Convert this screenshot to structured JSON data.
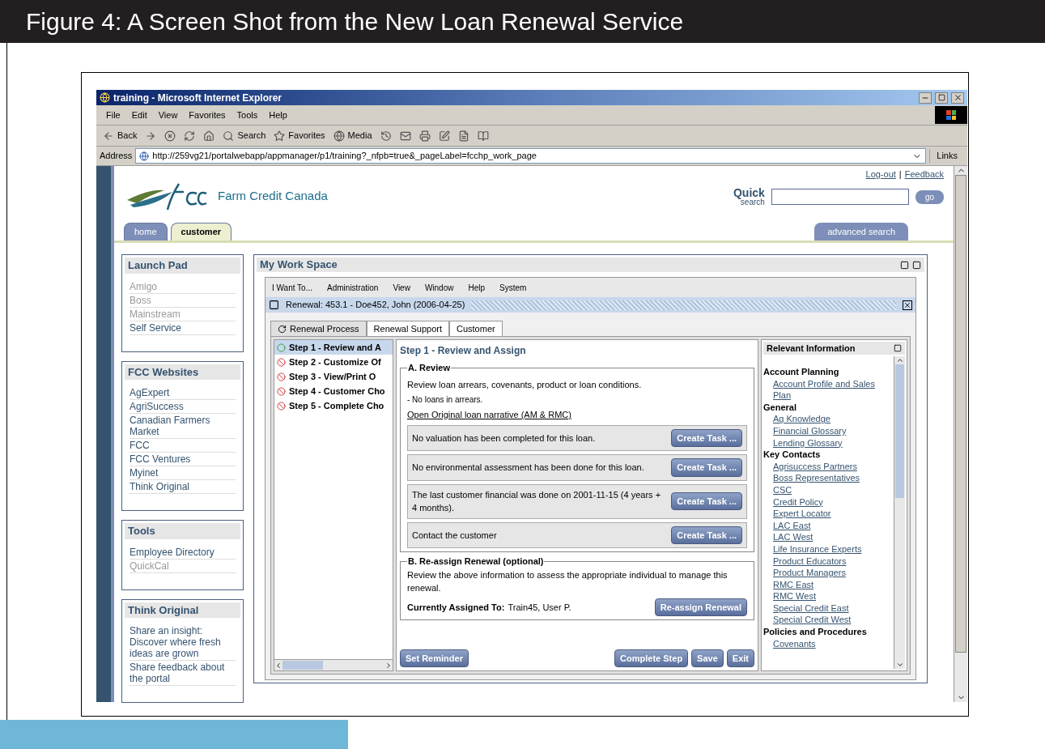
{
  "figure": {
    "caption": "Figure 4: A Screen Shot from the New Loan Renewal Service"
  },
  "browser": {
    "title": "training - Microsoft Internet Explorer",
    "menu": [
      "File",
      "Edit",
      "View",
      "Favorites",
      "Tools",
      "Help"
    ],
    "toolbar": [
      {
        "kind": "back",
        "label": "Back"
      },
      {
        "kind": "forward"
      },
      {
        "kind": "stop"
      },
      {
        "kind": "refresh"
      },
      {
        "kind": "home"
      },
      {
        "kind": "search",
        "label": "Search"
      },
      {
        "kind": "favorites",
        "label": "Favorites"
      },
      {
        "kind": "media",
        "label": "Media"
      },
      {
        "kind": "history"
      },
      {
        "kind": "mail"
      },
      {
        "kind": "print"
      },
      {
        "kind": "edit"
      },
      {
        "kind": "page"
      },
      {
        "kind": "research"
      }
    ],
    "address_label": "Address",
    "url": "http://259vg21/portalwebapp/appmanager/p1/training?_nfpb=true&_pageLabel=fcchp_work_page",
    "links_label": "Links"
  },
  "portal": {
    "brand": "Farm Credit Canada",
    "header_links": [
      "Log-out",
      "Feedback"
    ],
    "separator": "|",
    "quick": "Quick",
    "quick_sub": "search",
    "go": "go",
    "tabs": [
      {
        "label": "home",
        "selected": false
      },
      {
        "label": "customer",
        "selected": true
      }
    ],
    "advanced_search": "advanced search"
  },
  "sidebar": [
    {
      "title": "Launch Pad",
      "items": [
        {
          "label": "Amigo",
          "disabled": true
        },
        {
          "label": "Boss",
          "disabled": true
        },
        {
          "label": "Mainstream",
          "disabled": true
        },
        {
          "label": "Self Service",
          "disabled": false
        }
      ]
    },
    {
      "title": "FCC Websites",
      "items": [
        {
          "label": "AgExpert",
          "disabled": false
        },
        {
          "label": "AgriSuccess",
          "disabled": false
        },
        {
          "label": "Canadian Farmers Market",
          "disabled": false
        },
        {
          "label": "FCC",
          "disabled": false
        },
        {
          "label": "FCC Ventures",
          "disabled": false
        },
        {
          "label": "Myinet",
          "disabled": false
        },
        {
          "label": "Think Original",
          "disabled": false
        }
      ]
    },
    {
      "title": "Tools",
      "items": [
        {
          "label": "Employee Directory",
          "disabled": false
        },
        {
          "label": "QuickCal",
          "disabled": true
        }
      ]
    },
    {
      "title": "Think Original",
      "items": [
        {
          "label": "Share an insight: Discover where fresh ideas are grown",
          "disabled": false
        },
        {
          "label": "Share feedback about the portal",
          "disabled": false
        }
      ]
    }
  ],
  "workspace": {
    "title": "My Work Space",
    "menu": [
      "I Want To...",
      "Administration",
      "View",
      "Window",
      "Help",
      "System"
    ],
    "renewal_title": "Renewal: 453.1 - Doe452, John (2006-04-25)",
    "tabs": [
      {
        "label": "Renewal Process",
        "selected": true
      },
      {
        "label": "Renewal Support",
        "selected": false
      },
      {
        "label": "Customer",
        "selected": false
      }
    ],
    "steps": [
      {
        "label": "Step 1 - Review and A",
        "kind": "open",
        "selected": true
      },
      {
        "label": "Step 2 - Customize Of",
        "kind": "blocked",
        "selected": false
      },
      {
        "label": "Step 3 - View/Print O",
        "kind": "blocked",
        "selected": false
      },
      {
        "label": "Step 4 - Customer Cho",
        "kind": "blocked",
        "selected": false
      },
      {
        "label": "Step 5 - Complete Cho",
        "kind": "blocked",
        "selected": false
      }
    ],
    "step_title": "Step 1 - Review and Assign",
    "section_a": {
      "legend": "A. Review",
      "intro": "Review loan arrears, covenants, product or loan conditions.",
      "note": "- No loans in arrears.",
      "link": "Open Original loan narrative (AM & RMC)",
      "tasks": [
        {
          "text": "No valuation has been completed for this loan.",
          "button": "Create Task ..."
        },
        {
          "text": "No environmental assessment has been done for this loan.",
          "button": "Create Task ..."
        },
        {
          "text": "The last customer financial was done on 2001-11-15 (4 years + 4 months).",
          "button": "Create Task ..."
        },
        {
          "text": "Contact the customer",
          "button": "Create Task ..."
        }
      ]
    },
    "section_b": {
      "legend": "B. Re-assign Renewal (optional)",
      "text": "Review the above information to assess the appropriate individual to manage this renewal.",
      "assigned_label": "Currently Assigned To:",
      "assigned_value": "Train45, User P.",
      "button": "Re-assign Renewal"
    },
    "left_button": "Set Reminder",
    "right_buttons": [
      "Complete Step",
      "Save",
      "Exit"
    ]
  },
  "relevant": {
    "title": "Relevant Information",
    "groups": [
      {
        "title": "Account Planning",
        "links": [
          "Account Profile and Sales Plan"
        ]
      },
      {
        "title": "General",
        "links": [
          "Ag Knowledge",
          "Financial Glossary",
          "Lending Glossary"
        ]
      },
      {
        "title": "Key Contacts",
        "links": [
          "Agrisuccess Partners",
          "Boss Representatives",
          "CSC",
          "Credit Policy",
          "Expert Locator",
          "LAC East",
          "LAC West",
          "Life Insurance Experts",
          "Product Educators",
          "Product Managers",
          "RMC East",
          "RMC West",
          "Special Credit East",
          "Special Credit West"
        ]
      },
      {
        "title": "Policies and Procedures",
        "links": [
          "Covenants"
        ]
      }
    ]
  }
}
